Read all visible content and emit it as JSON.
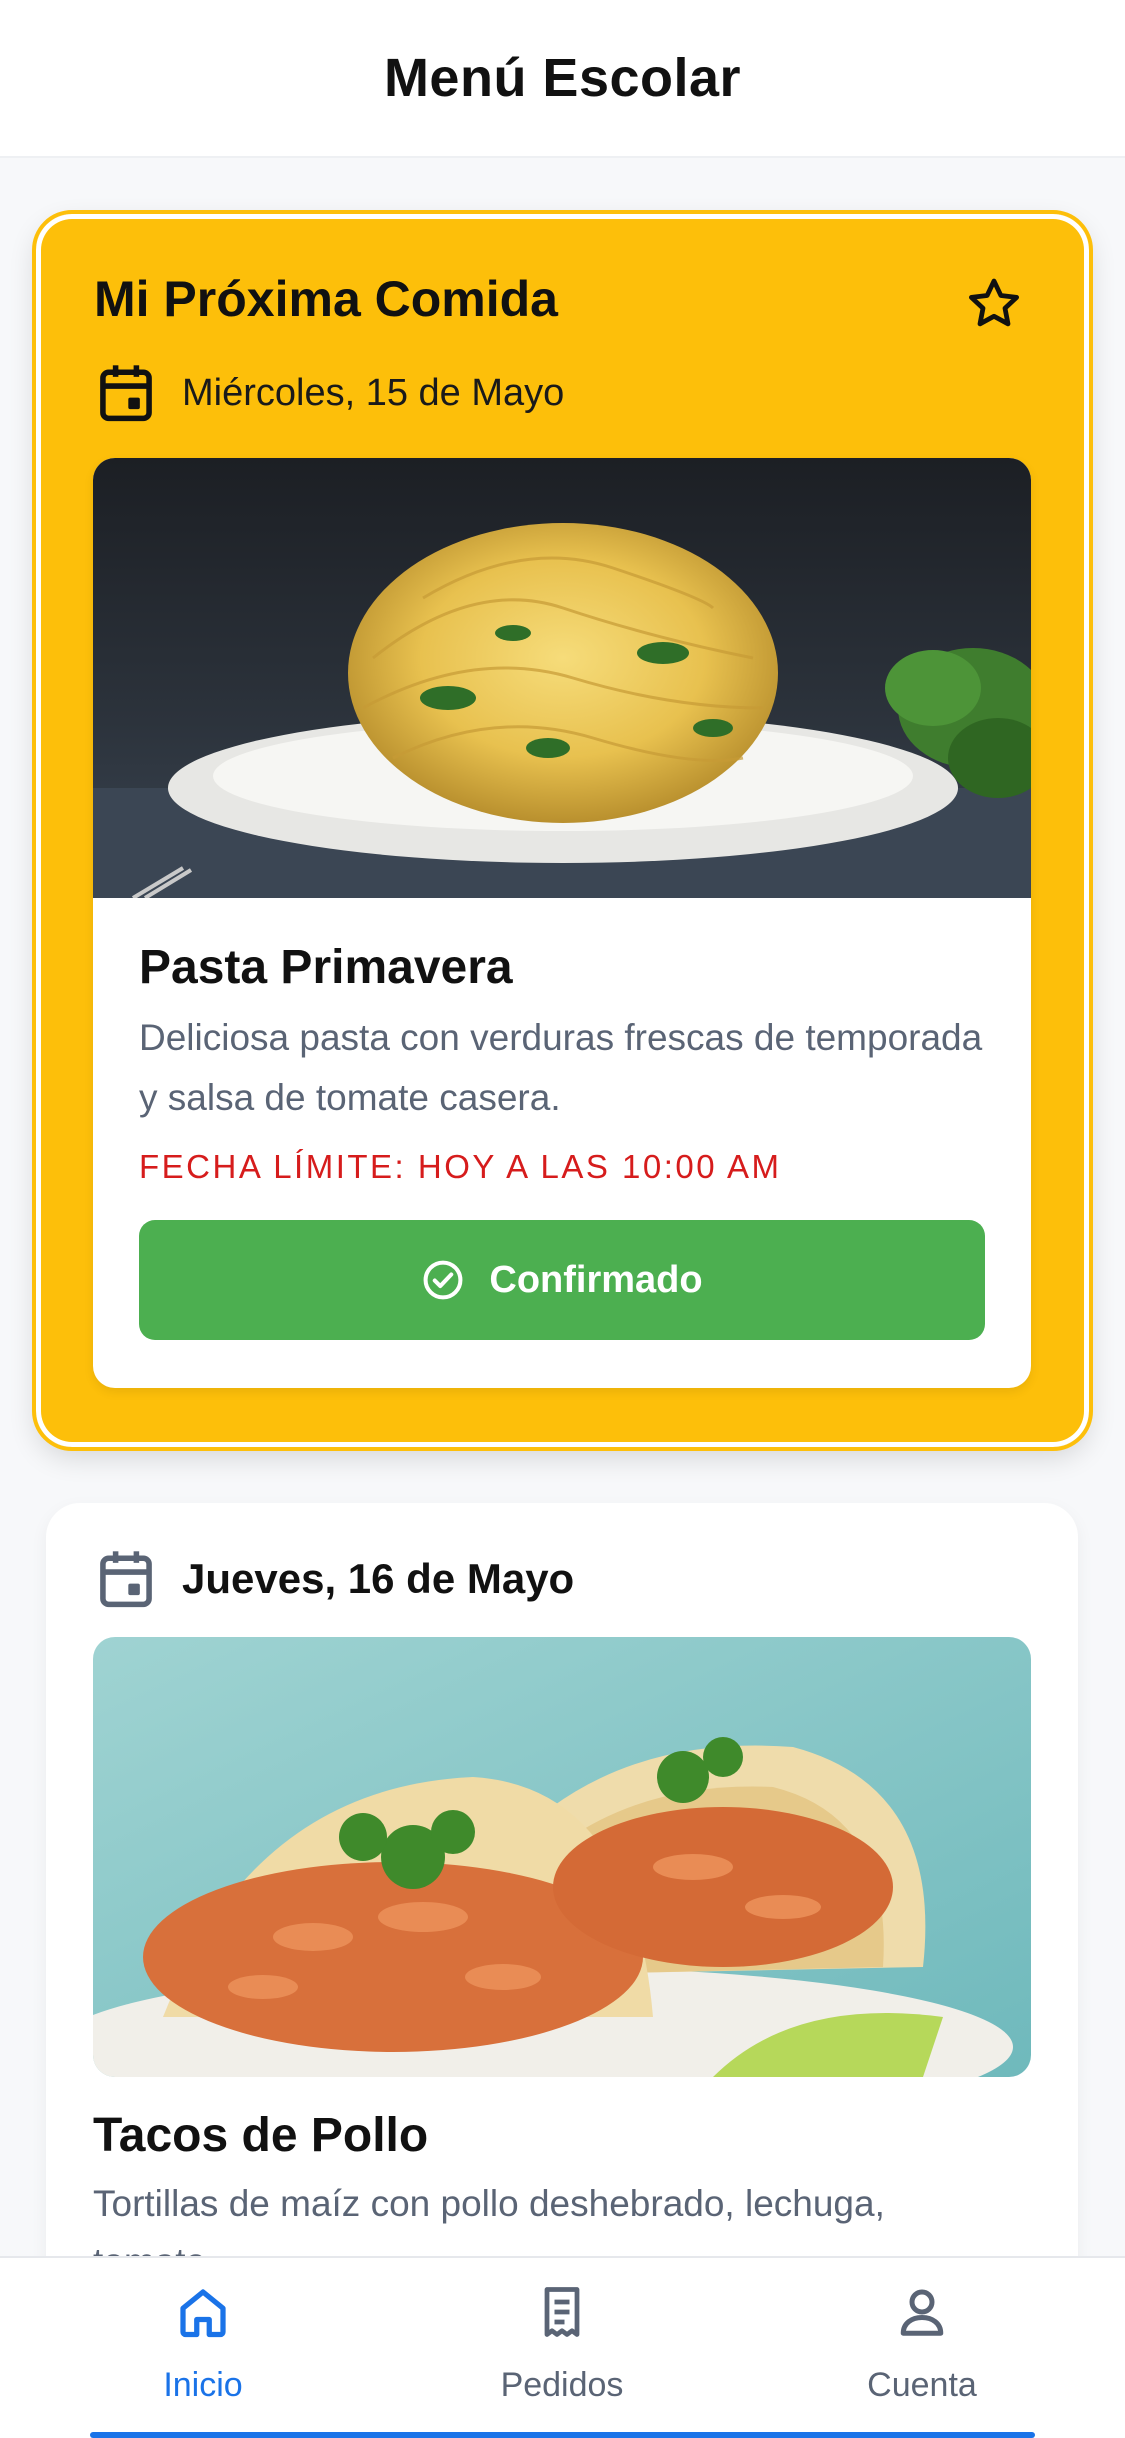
{
  "header": {
    "title": "Menú Escolar"
  },
  "featured": {
    "title": "Mi Próxima Comida",
    "favorite_icon": "star-icon",
    "date": "Miércoles, 15 de Mayo",
    "meal": {
      "name": "Pasta Primavera",
      "description": "Deliciosa pasta con verduras frescas de temporada y salsa de tomate casera.",
      "deadline": "FECHA LÍMITE: HOY A LAS 10:00 AM",
      "button_label": "Confirmado"
    }
  },
  "upcoming": {
    "date": "Jueves, 16 de Mayo",
    "meal": {
      "name": "Tacos de Pollo",
      "description": "Tortillas de maíz con pollo deshebrado, lechuga, tomate..."
    }
  },
  "bottom_nav": {
    "items": [
      {
        "label": "Inicio",
        "icon": "home-icon",
        "active": true
      },
      {
        "label": "Pedidos",
        "icon": "receipt-icon",
        "active": false
      },
      {
        "label": "Cuenta",
        "icon": "user-icon",
        "active": false
      }
    ]
  },
  "colors": {
    "featured_bg": "#fdbf0a",
    "confirm_green": "#4caf50",
    "deadline_red": "#d61c1c",
    "nav_active": "#1a73e8"
  }
}
